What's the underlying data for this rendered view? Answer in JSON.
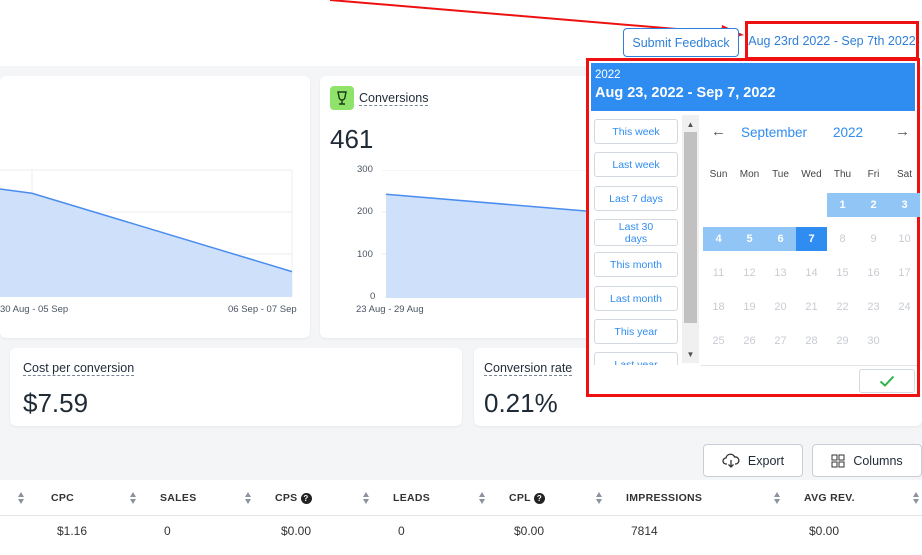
{
  "header": {
    "feedback_label": "Submit Feedback",
    "date_range_label": "Aug 23rd 2022 - Sep 7th 2022"
  },
  "cards": {
    "chart1": {
      "x_labels": [
        "30 Aug - 05 Sep",
        "06 Sep - 07 Sep"
      ]
    },
    "conversions": {
      "label": "Conversions",
      "value": "461",
      "icon": "bulb-icon"
    },
    "cost_per_conversion": {
      "label": "Cost per conversion",
      "value": "$7.59"
    },
    "conversion_rate": {
      "label": "Conversion rate",
      "value": "0.21%"
    }
  },
  "chart_data": [
    {
      "type": "area",
      "x": [
        "…",
        "30 Aug - 05 Sep",
        "06 Sep - 07 Sep"
      ],
      "values": [
        255,
        245,
        60
      ],
      "color": "#4a8df0",
      "fill": "#cfe0fb"
    },
    {
      "type": "area",
      "x": [
        "23 Aug - 29 Aug",
        "30 Aug - 05 Sep"
      ],
      "values": [
        245,
        200
      ],
      "ylim": [
        0,
        300
      ],
      "yticks": [
        "300",
        "200",
        "100",
        "0"
      ],
      "x_labels": [
        "23 Aug - 29 Aug"
      ],
      "color": "#4a8df0",
      "fill": "#cfe0fb"
    }
  ],
  "toolbar": {
    "export_label": "Export",
    "columns_label": "Columns"
  },
  "table": {
    "headers": [
      "CPC",
      "SALES",
      "CPS",
      "LEADS",
      "CPL",
      "IMPRESSIONS",
      "AVG REV."
    ],
    "row": [
      "$1.16",
      "0",
      "$0.00",
      "0",
      "$0.00",
      "7814",
      "$0.00"
    ]
  },
  "picker": {
    "year": "2022",
    "range": "Aug 23, 2022 - Sep 7, 2022",
    "presets": [
      "This week",
      "Last week",
      "Last 7 days",
      "Last 30 days",
      "This month",
      "Last month",
      "This year",
      "Last year"
    ],
    "month": "September",
    "cal_year": "2022",
    "weekdays": [
      "Sun",
      "Mon",
      "Tue",
      "Wed",
      "Thu",
      "Fri",
      "Sat"
    ],
    "days": [
      "1",
      "2",
      "3",
      "4",
      "5",
      "6",
      "7",
      "8",
      "9",
      "10",
      "11",
      "12",
      "13",
      "14",
      "15",
      "16",
      "17",
      "18",
      "19",
      "20",
      "21",
      "22",
      "23",
      "24",
      "25",
      "26",
      "27",
      "28",
      "29",
      "30"
    ],
    "selected_through": 7,
    "accent": "#2f8cf0",
    "selected_color": "#90c5f5"
  }
}
